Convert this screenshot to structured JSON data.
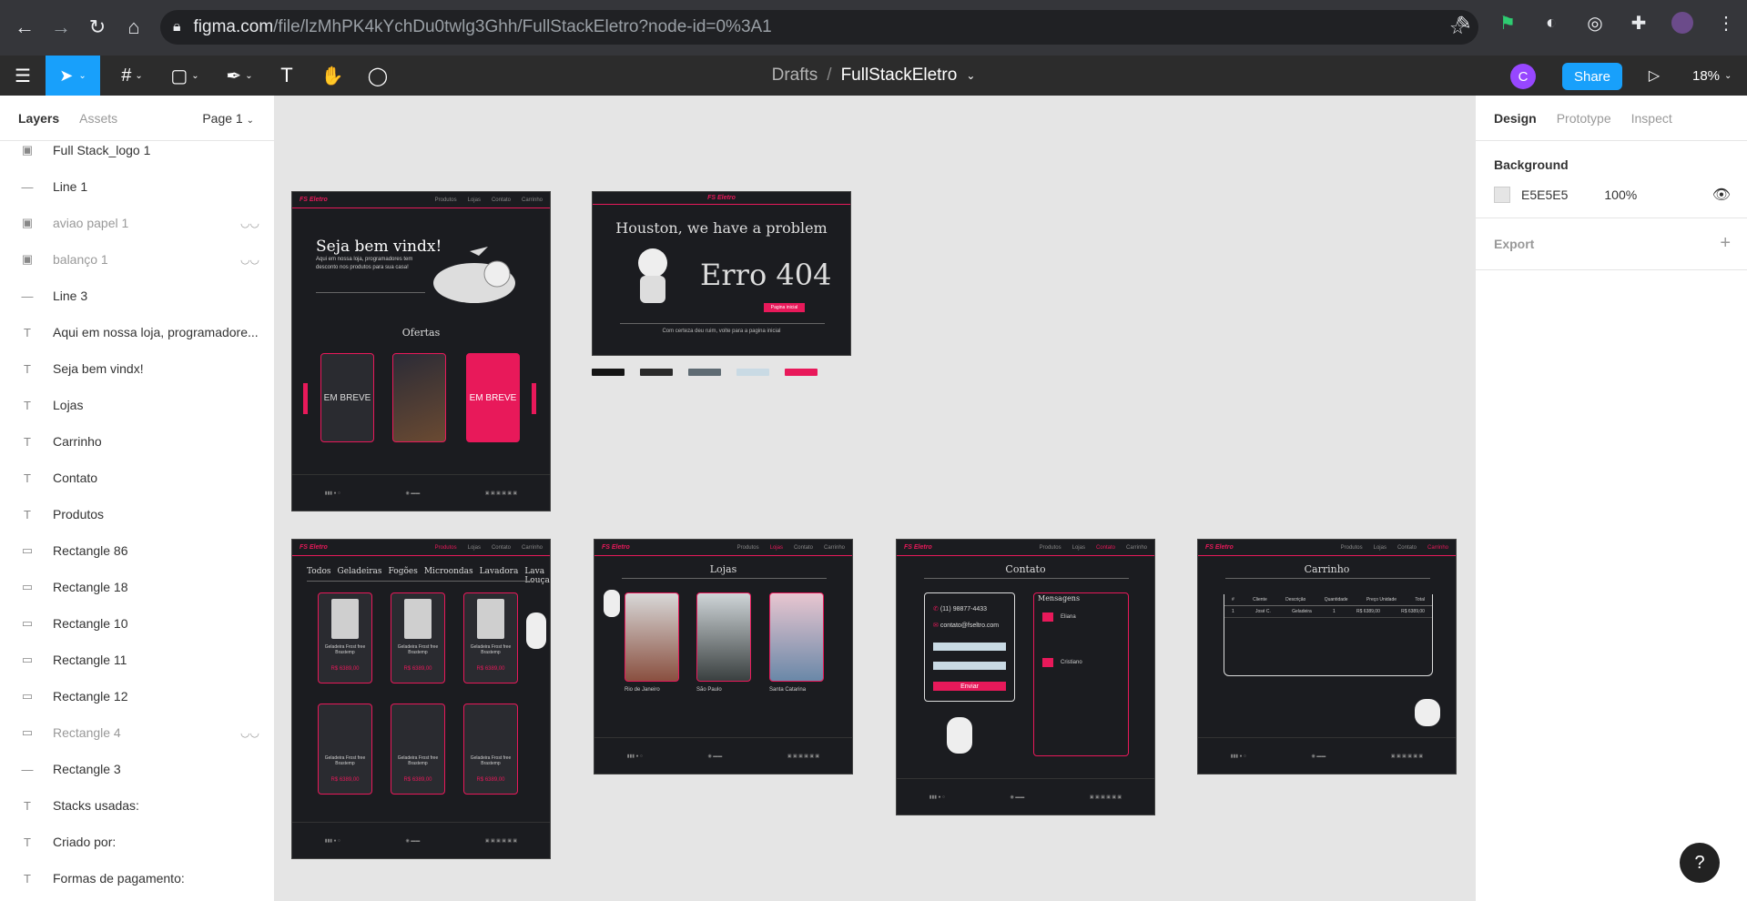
{
  "browser": {
    "url_main": "figma.com",
    "url_path": "/file/lzMhPK4kYchDu0twlg3Ghh/FullStackEletro?node-id=0%3A1"
  },
  "toolbar": {
    "breadcrumb_drafts": "Drafts",
    "breadcrumb_sep": "/",
    "file_name": "FullStackEletro",
    "avatar_letter": "C",
    "share_label": "Share",
    "zoom_label": "18%"
  },
  "left_panel": {
    "tab_layers": "Layers",
    "tab_assets": "Assets",
    "page_label": "Page 1",
    "layers": [
      {
        "name": "Full Stack_logo 1",
        "type": "image",
        "hidden": false
      },
      {
        "name": "Line 1",
        "type": "line",
        "hidden": false
      },
      {
        "name": "aviao papel 1",
        "type": "image",
        "hidden": true
      },
      {
        "name": "balanço 1",
        "type": "image",
        "hidden": true
      },
      {
        "name": "Line 3",
        "type": "line",
        "hidden": false
      },
      {
        "name": "Aqui em nossa loja, programadore...",
        "type": "text",
        "hidden": false
      },
      {
        "name": "Seja bem vindx!",
        "type": "text",
        "hidden": false
      },
      {
        "name": "Lojas",
        "type": "text",
        "hidden": false
      },
      {
        "name": "Carrinho",
        "type": "text",
        "hidden": false
      },
      {
        "name": "Contato",
        "type": "text",
        "hidden": false
      },
      {
        "name": "Produtos",
        "type": "text",
        "hidden": false
      },
      {
        "name": "Rectangle 86",
        "type": "rect",
        "hidden": false
      },
      {
        "name": "Rectangle 18",
        "type": "rect",
        "hidden": false
      },
      {
        "name": "Rectangle 10",
        "type": "rect",
        "hidden": false
      },
      {
        "name": "Rectangle 11",
        "type": "rect",
        "hidden": false
      },
      {
        "name": "Rectangle 12",
        "type": "rect",
        "hidden": false
      },
      {
        "name": "Rectangle 4",
        "type": "rect",
        "hidden": true
      },
      {
        "name": "Rectangle 3",
        "type": "line",
        "hidden": false
      },
      {
        "name": "Stacks usadas:",
        "type": "text",
        "hidden": false
      },
      {
        "name": "Criado por:",
        "type": "text",
        "hidden": false
      },
      {
        "name": "Formas de pagamento:",
        "type": "text",
        "hidden": false
      }
    ]
  },
  "right_panel": {
    "tab_design": "Design",
    "tab_prototype": "Prototype",
    "tab_inspect": "Inspect",
    "background_title": "Background",
    "bg_hex": "E5E5E5",
    "bg_opacity": "100%",
    "export_label": "Export"
  },
  "canvas": {
    "home": {
      "nav": [
        "Produtos",
        "Lojas",
        "Contato",
        "Carrinho"
      ],
      "welcome": "Seja bem vindx!",
      "intro": "Aqui em nossa loja, programadores tem desconto nos produtos para sua casa!",
      "offers_title": "Ofertas",
      "soon_left": "EM BREVE",
      "soon_right": "EM BREVE"
    },
    "error": {
      "headline": "Houston, we have a problem",
      "code": "Erro 404",
      "button": "Pagina inicial",
      "note": "Com certeza deu ruim, volte para a pagina inicial"
    },
    "products": {
      "categories": [
        "Todos",
        "Geladeiras",
        "Fogões",
        "Microondas",
        "Lavadora",
        "Lava Louças"
      ],
      "item_name": "Geladeira Frost free Brastemp",
      "old_price": "R$ 6.389,00",
      "new_price": "R$ 6389,00"
    },
    "stores": {
      "title": "Lojas",
      "cities": [
        "Rio de Janeiro",
        "São Paulo",
        "Santa Catarina"
      ]
    },
    "contact": {
      "title": "Contato",
      "phone": "(11) 98877-4433",
      "email": "contato@fseltro.com",
      "send": "Enviar",
      "messages_title": "Mensagens",
      "msg_authors": [
        "Eliana",
        "Cristiano"
      ]
    },
    "cart": {
      "title": "Carrinho",
      "headers": [
        "#",
        "Cliente",
        "Descrição",
        "Quantidade",
        "Preço Unidade",
        "Total"
      ],
      "row": [
        "1",
        "José C.",
        "Geladeira",
        "1",
        "R$ 6389,00",
        "R$ 6389,00"
      ]
    },
    "palette": [
      "#151515",
      "#2a2a2a",
      "#5f6b73",
      "#c9dae4",
      "#e8195a"
    ]
  }
}
